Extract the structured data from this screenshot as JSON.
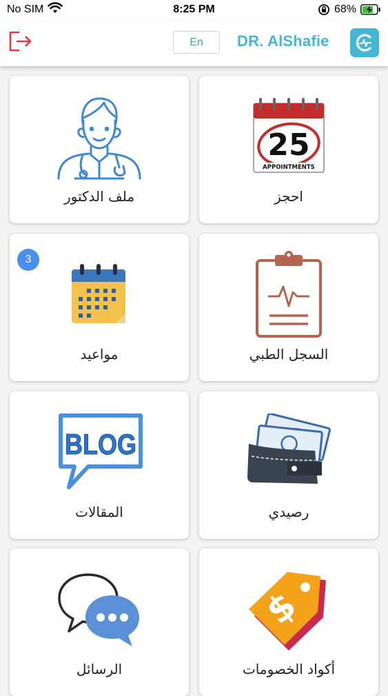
{
  "status_bar": {
    "carrier": "No SIM",
    "time": "8:25 PM",
    "battery": "68%"
  },
  "header": {
    "lang_button": "En",
    "brand": "DR. AlShafie"
  },
  "tiles": [
    {
      "label": "احجز",
      "icon": "calendar-25-icon",
      "calendar_number": "25",
      "calendar_caption": "APPOINTMENTS"
    },
    {
      "label": "ملف الدكتور",
      "icon": "doctor-icon"
    },
    {
      "label": "السجل الطبي",
      "icon": "clipboard-medical-icon"
    },
    {
      "label": "مواعيد",
      "icon": "calendar-icon",
      "badge": "3"
    },
    {
      "label": "رصيدي",
      "icon": "wallet-icon"
    },
    {
      "label": "المقالات",
      "icon": "blog-icon",
      "icon_text": "BLOG"
    },
    {
      "label": "أكواد الخصومات",
      "icon": "discount-tag-icon",
      "icon_text": "$"
    },
    {
      "label": "الرسائل",
      "icon": "chat-icon"
    }
  ],
  "colors": {
    "brand": "#45b6d4",
    "logout": "#e0383e",
    "badge": "#4a8ff0"
  }
}
